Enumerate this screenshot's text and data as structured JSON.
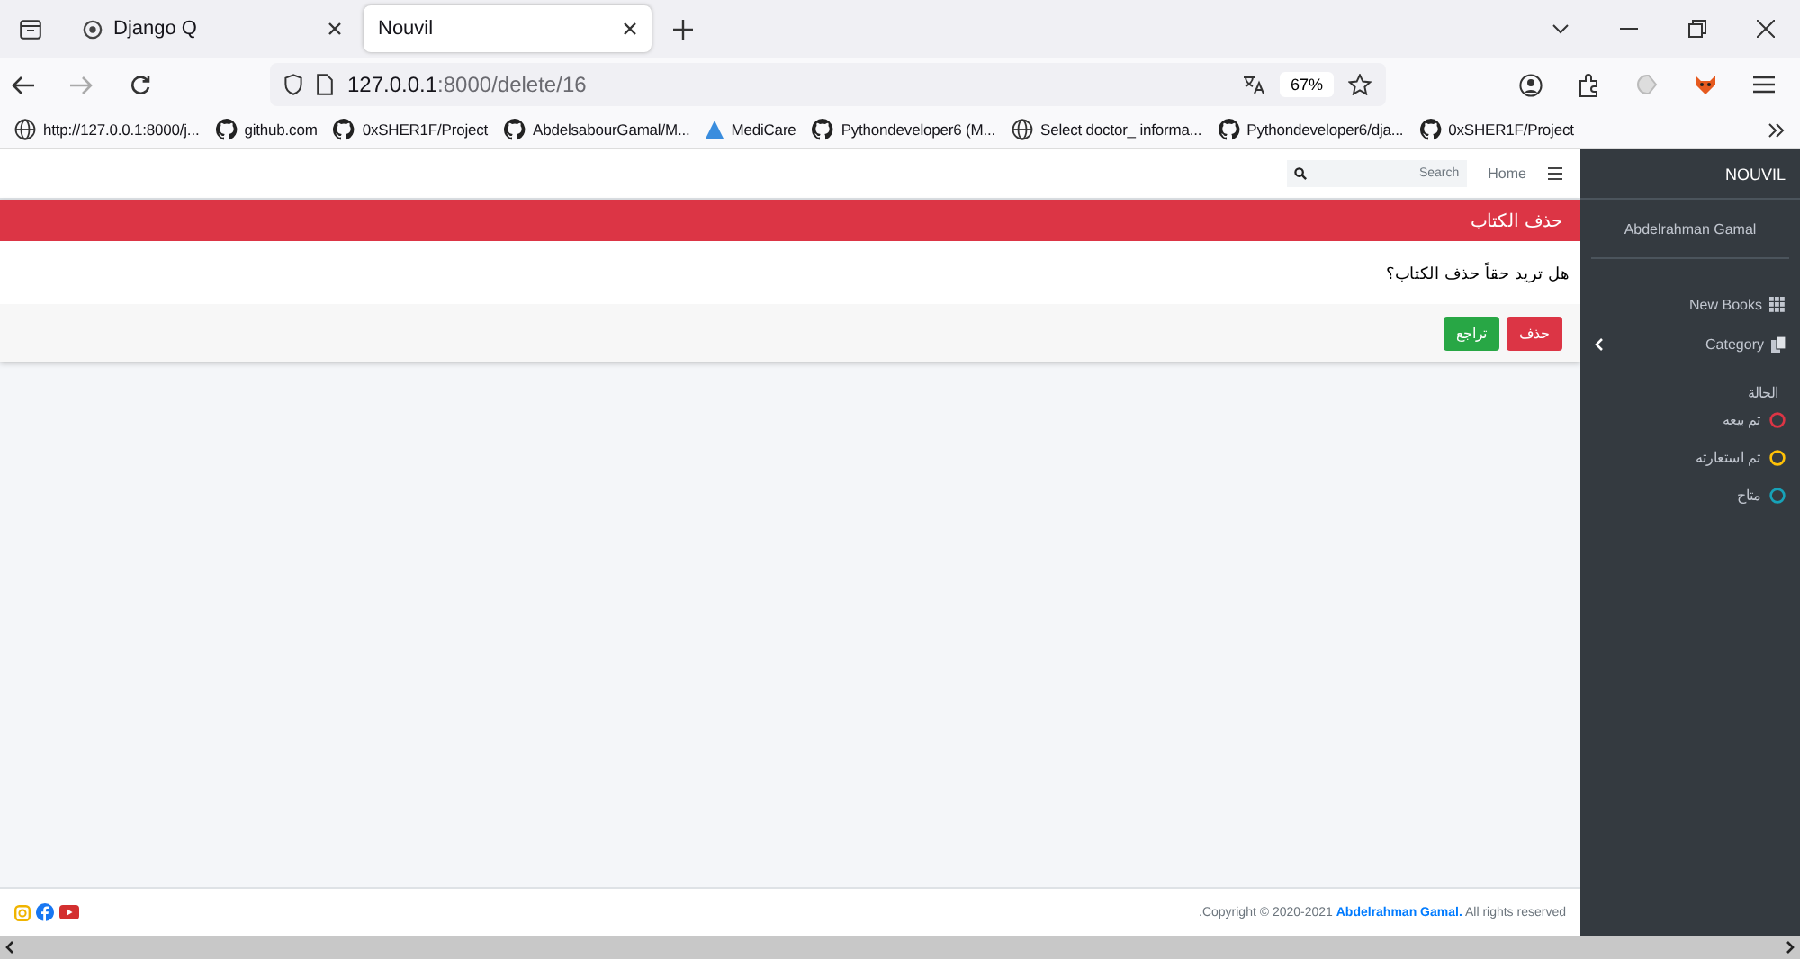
{
  "browser": {
    "tabs": [
      {
        "label": "Django Q",
        "selected": false
      },
      {
        "label": "Nouvil",
        "selected": true
      }
    ],
    "url_host": "127.0.0.1",
    "url_path": ":8000/delete/16",
    "zoom": "67%",
    "bookmarks": [
      {
        "label": "http://127.0.0.1:8000/j...",
        "kind": "globe"
      },
      {
        "label": "github.com",
        "kind": "github"
      },
      {
        "label": "0xSHER1F/Project",
        "kind": "github"
      },
      {
        "label": "AbdelsabourGamal/M...",
        "kind": "github"
      },
      {
        "label": "MediCare",
        "kind": "triangle"
      },
      {
        "label": "Pythondeveloper6 (M...",
        "kind": "github"
      },
      {
        "label": "Select doctor_ informa...",
        "kind": "globe"
      },
      {
        "label": "Pythondeveloper6/dja...",
        "kind": "github"
      },
      {
        "label": "0xSHER1F/Project",
        "kind": "github"
      }
    ]
  },
  "navbar": {
    "search_placeholder": "Search",
    "home": "Home"
  },
  "card": {
    "title": "حذف الكتاب",
    "question": "هل تريد حقاً حذف الكتاب؟",
    "buttons": [
      {
        "label": "حذف",
        "kind": "danger"
      },
      {
        "label": "تراجع",
        "kind": "success"
      }
    ]
  },
  "footer": {
    "copyright": ".Copyright © 2020-2021 **Abdelrahman Gamal.** All rights reserved"
  },
  "sidebar": {
    "brand": "NOUVIL",
    "user": "Abdelrahman Gamal",
    "items": [
      {
        "label": "New Books",
        "kind": "grid"
      },
      {
        "label": "Category",
        "kind": "copy"
      }
    ],
    "status_title": "الحالة",
    "statuses": [
      {
        "label": "تم بيعه",
        "color": "#dc3545"
      },
      {
        "label": "تم استعارته",
        "color": "#ffc107"
      },
      {
        "label": "متاح",
        "color": "#17a2b8"
      }
    ]
  }
}
